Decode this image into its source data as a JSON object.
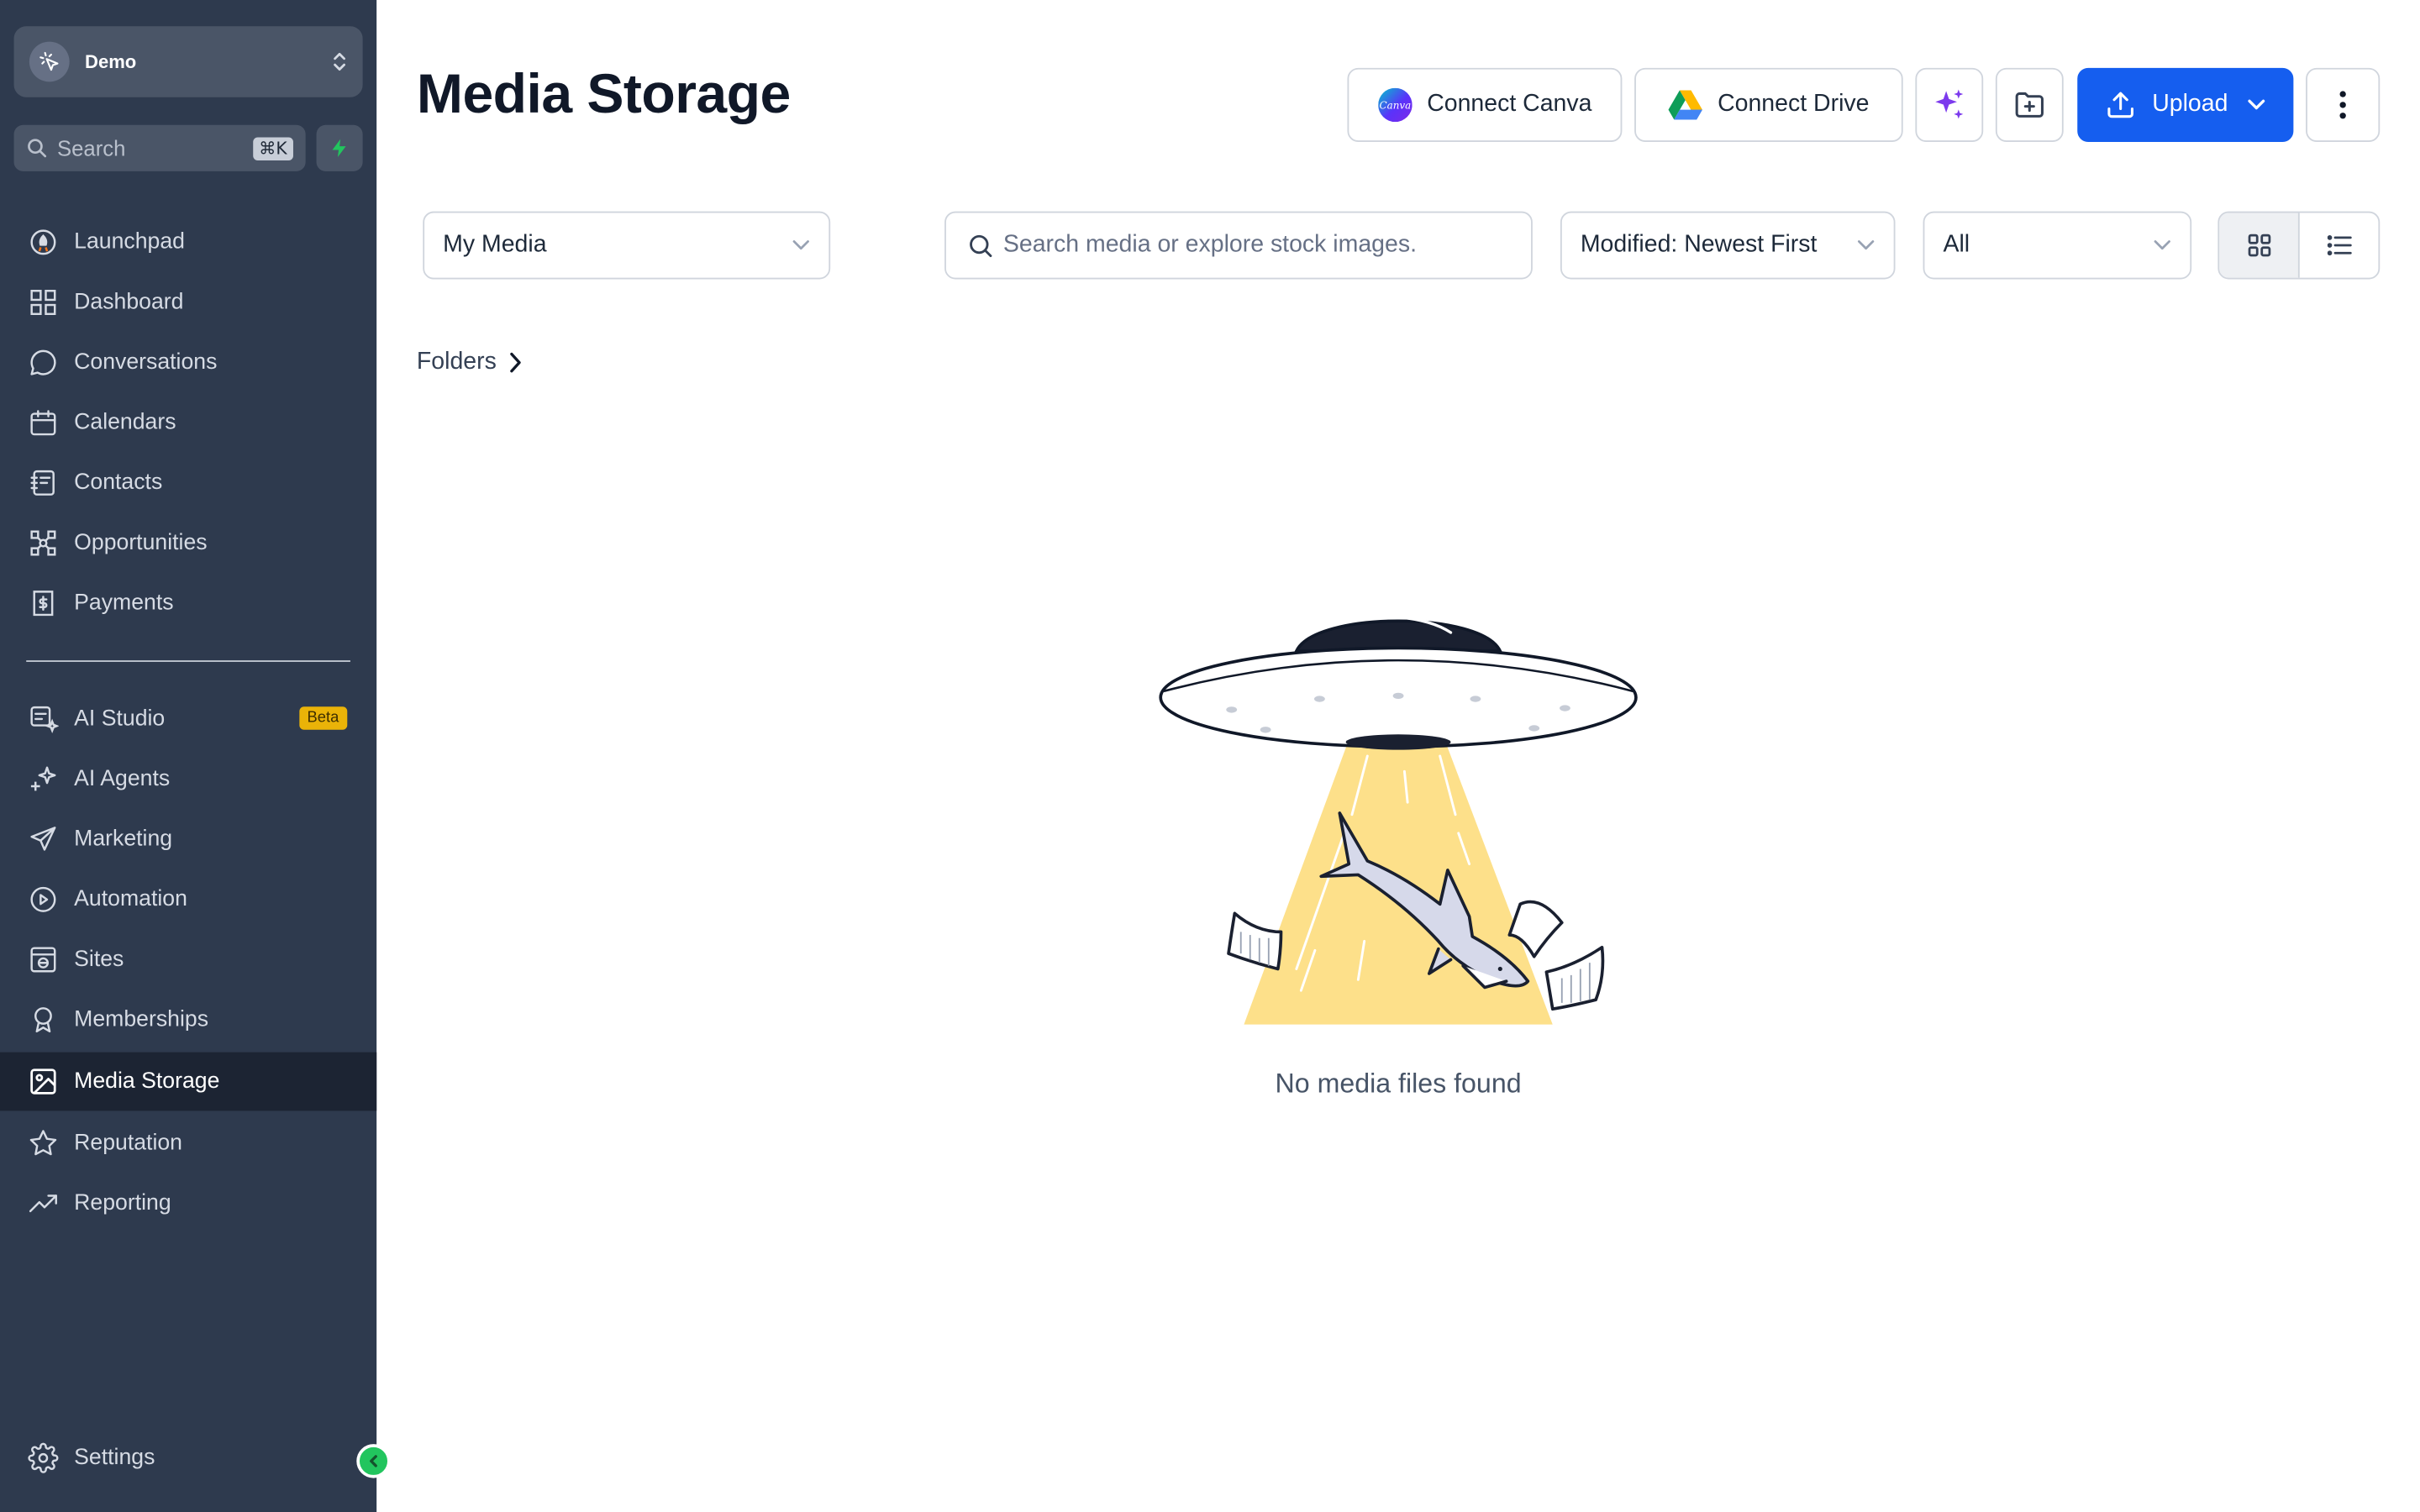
{
  "account": {
    "name": "Demo"
  },
  "sidebar": {
    "search_placeholder": "Search",
    "search_shortcut": "⌘K",
    "items": [
      {
        "label": "Launchpad",
        "icon": "launchpad-icon"
      },
      {
        "label": "Dashboard",
        "icon": "dashboard-icon"
      },
      {
        "label": "Conversations",
        "icon": "chat-bubble-icon"
      },
      {
        "label": "Calendars",
        "icon": "calendar-icon"
      },
      {
        "label": "Contacts",
        "icon": "contacts-book-icon"
      },
      {
        "label": "Opportunities",
        "icon": "opportunities-icon"
      },
      {
        "label": "Payments",
        "icon": "receipt-icon"
      }
    ],
    "items2": [
      {
        "label": "AI Studio",
        "icon": "ai-studio-icon",
        "badge": "Beta"
      },
      {
        "label": "AI Agents",
        "icon": "sparkles-icon"
      },
      {
        "label": "Marketing",
        "icon": "send-icon"
      },
      {
        "label": "Automation",
        "icon": "automation-icon"
      },
      {
        "label": "Sites",
        "icon": "globe-window-icon"
      },
      {
        "label": "Memberships",
        "icon": "award-icon"
      },
      {
        "label": "Media Storage",
        "icon": "image-icon",
        "active": true
      },
      {
        "label": "Reputation",
        "icon": "star-icon"
      },
      {
        "label": "Reporting",
        "icon": "trend-up-icon"
      }
    ],
    "settings_label": "Settings"
  },
  "header": {
    "title": "Media Storage",
    "connect_canva": "Connect Canva",
    "canva_logo_text": "Canva",
    "connect_drive": "Connect Drive",
    "upload": "Upload"
  },
  "filters": {
    "library": "My Media",
    "search_placeholder": "Search media or explore stock images.",
    "sort": "Modified: Newest First",
    "type": "All"
  },
  "folders_label": "Folders",
  "empty_state": "No media files found",
  "colors": {
    "sidebar_bg": "#2e3a4e",
    "active_bg": "#1c2433",
    "primary": "#155eef",
    "beta": "#eab308",
    "ai_purple": "#7c3aed"
  }
}
